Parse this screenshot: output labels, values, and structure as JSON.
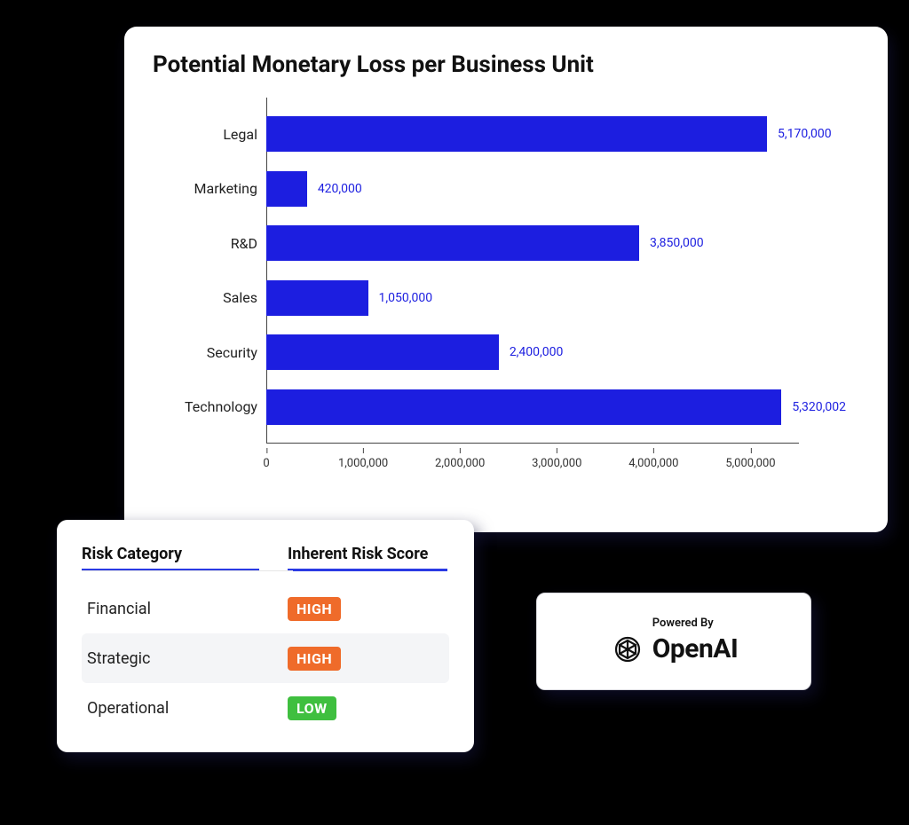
{
  "chart_data": {
    "type": "bar",
    "orientation": "horizontal",
    "title": "Potential Monetary Loss per Business Unit",
    "categories": [
      "Legal",
      "Marketing",
      "R&D",
      "Sales",
      "Security",
      "Technology"
    ],
    "values": [
      5170000,
      420000,
      3850000,
      1050000,
      2400000,
      5320002
    ],
    "value_labels": [
      "5,170,000",
      "420,000",
      "3,850,000",
      "1,050,000",
      "2,400,000",
      "5,320,002"
    ],
    "xlabel": "",
    "ylabel": "",
    "xlim": [
      0,
      5500000
    ],
    "x_ticks": [
      0,
      1000000,
      2000000,
      3000000,
      4000000,
      5000000
    ],
    "x_tick_labels": [
      "0",
      "1,000,000",
      "2,000,000",
      "3,000,000",
      "4,000,000",
      "5,000,000"
    ],
    "bar_color": "#1c1ee0"
  },
  "risk_table": {
    "header_category": "Risk Category",
    "header_score": "Inherent Risk Score",
    "rows": [
      {
        "name": "Financial",
        "score": "HIGH",
        "level": "high"
      },
      {
        "name": "Strategic",
        "score": "HIGH",
        "level": "high"
      },
      {
        "name": "Operational",
        "score": "LOW",
        "level": "low"
      }
    ]
  },
  "powered": {
    "label": "Powered By",
    "brand": "OpenAI"
  }
}
